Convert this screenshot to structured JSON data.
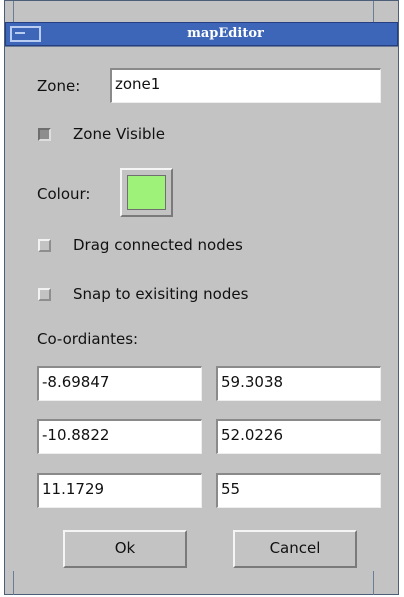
{
  "window": {
    "title": "mapEditor"
  },
  "zone": {
    "label": "Zone:",
    "value": "zone1"
  },
  "zone_visible": {
    "label": "Zone Visible",
    "checked": true
  },
  "colour": {
    "label": "Colour:",
    "swatch_color": "#9ef27a"
  },
  "drag_connected": {
    "label": "Drag connected nodes",
    "checked": false
  },
  "snap_nodes": {
    "label": "Snap to exisiting nodes",
    "checked": false
  },
  "coordinates": {
    "label": "Co-ordiantes:",
    "rows": [
      {
        "x": "-8.69847",
        "y": "59.3038"
      },
      {
        "x": "-10.8822",
        "y": "52.0226"
      },
      {
        "x": "11.1729",
        "y": "55"
      }
    ]
  },
  "buttons": {
    "ok": "Ok",
    "cancel": "Cancel"
  },
  "colors": {
    "titlebar": "#3e66b8",
    "dialog_bg": "#c3c3c3"
  }
}
